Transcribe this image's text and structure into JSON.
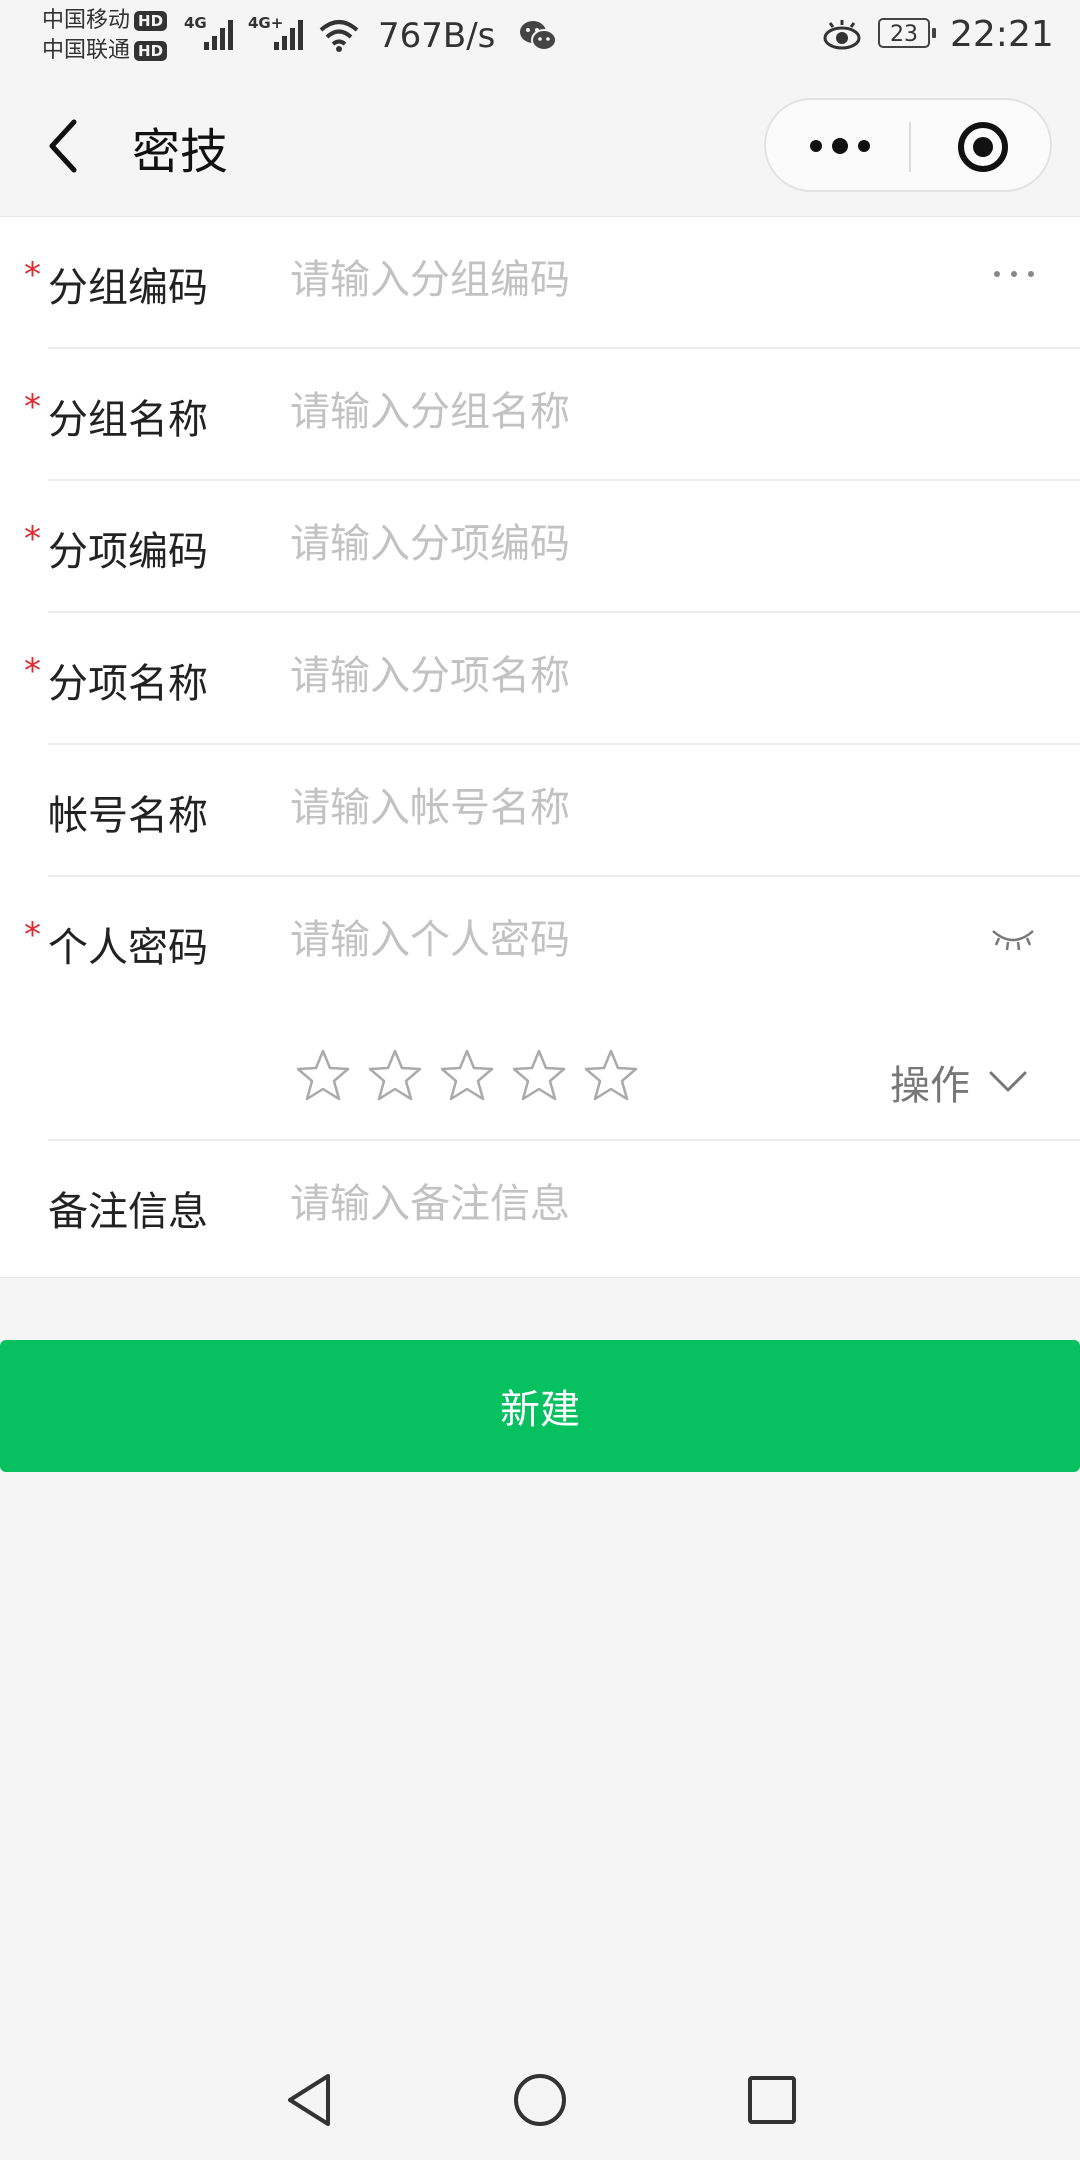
{
  "status_bar": {
    "carrier_1": "中国移动",
    "carrier_2": "中国联通",
    "hd_badge": "HD",
    "net_1": "4G",
    "net_2": "4G+",
    "speed": "767B/s",
    "battery": "23",
    "time": "22:21"
  },
  "nav": {
    "title": "密技"
  },
  "form": {
    "fields": [
      {
        "label": "分组编码",
        "placeholder": "请输入分组编码",
        "required": true
      },
      {
        "label": "分组名称",
        "placeholder": "请输入分组名称",
        "required": true
      },
      {
        "label": "分项编码",
        "placeholder": "请输入分项编码",
        "required": true
      },
      {
        "label": "分项名称",
        "placeholder": "请输入分项名称",
        "required": true
      },
      {
        "label": "帐号名称",
        "placeholder": "请输入帐号名称",
        "required": false
      },
      {
        "label": "个人密码",
        "placeholder": "请输入个人密码",
        "required": true
      },
      {
        "label": "备注信息",
        "placeholder": "请输入备注信息",
        "required": false
      }
    ],
    "required_mark": "*",
    "strength_rating": 0,
    "strength_max": 5,
    "ops_label": "操作"
  },
  "actions": {
    "create_label": "新建"
  },
  "colors": {
    "primary": "#07c160",
    "required": "#e0282e",
    "placeholder": "#c2c2c2"
  }
}
